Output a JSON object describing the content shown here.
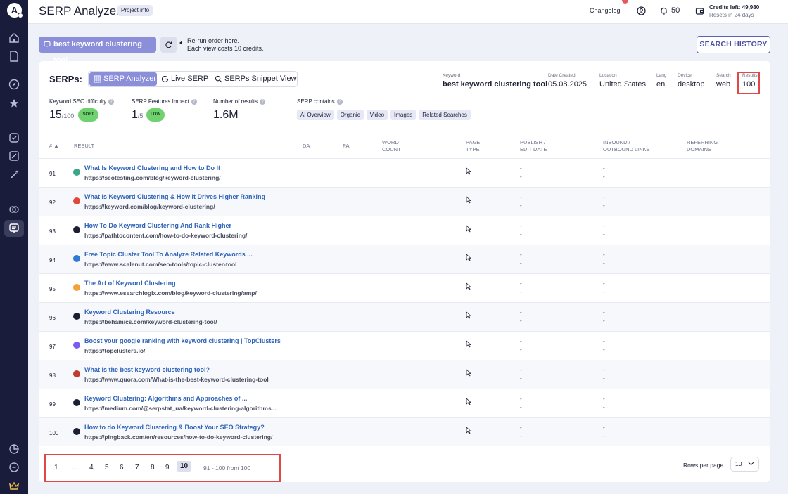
{
  "app": {
    "title": "SERP Analyzer",
    "project_info": "Project info"
  },
  "header": {
    "changelog": "Changelog",
    "notifications_count": "50",
    "credits_left": "Credits left: 49,980",
    "credits_reset": "Resets in 24 days"
  },
  "query": {
    "keyword_chip": "best keyword clustering tool",
    "rerun_line1": "Re-run order here.",
    "rerun_line2": "Each view costs 10 credits.",
    "search_history": "SEARCH HISTORY"
  },
  "serps": {
    "label": "SERPs:",
    "tabs": [
      "SERP Analyzer",
      "Live SERP",
      "SERPs Snippet View"
    ],
    "active_tab": "SERP Analyzer"
  },
  "meta": {
    "keyword_label": "Keyword",
    "keyword": "best keyword clustering tool",
    "date_label": "Date Created",
    "date": "05.08.2025",
    "location_label": "Location",
    "location": "United States",
    "lang_label": "Lang",
    "lang": "en",
    "device_label": "Device",
    "device": "desktop",
    "search_label": "Search",
    "search": "web",
    "results_label": "Results",
    "results": "100"
  },
  "metrics": {
    "difficulty_label": "Keyword SEO difficulty",
    "difficulty": "15",
    "difficulty_max": "/100",
    "difficulty_pill": "SOFT",
    "impact_label": "SERP Features Impact",
    "impact": "1",
    "impact_max": "/5",
    "impact_pill": "LOW",
    "num_results_label": "Number of results",
    "num_results": "1.6M",
    "contains_label": "SERP contains",
    "contains": [
      "Ai Overview",
      "Organic",
      "Video",
      "Images",
      "Related Searches"
    ]
  },
  "table": {
    "headers": {
      "num": "#",
      "result": "RESULT",
      "da": "DA",
      "pa": "PA",
      "word_count": [
        "WORD",
        "COUNT"
      ],
      "page_type": [
        "PAGE",
        "TYPE"
      ],
      "publish": [
        "PUBLISH /",
        "EDIT DATE"
      ],
      "links": [
        "INBOUND /",
        "OUTBOUND LINKS"
      ],
      "referring": [
        "REFERRING",
        "DOMAINS"
      ]
    },
    "rows": [
      {
        "num": "91",
        "title": "What Is Keyword Clustering and How to Do It",
        "url": "https://seotesting.com/blog/keyword-clustering/",
        "fav_color": "#3aa58a"
      },
      {
        "num": "92",
        "title": "What Is Keyword Clustering & How It Drives Higher Ranking",
        "url": "https://keyword.com/blog/keyword-clustering/",
        "fav_color": "#e0483a"
      },
      {
        "num": "93",
        "title": "How To Do Keyword Clustering And Rank Higher",
        "url": "https://pathtocontent.com/how-to-do-keyword-clustering/",
        "fav_color": "#1c1f33"
      },
      {
        "num": "94",
        "title": "Free Topic Cluster Tool To Analyze Related Keywords ...",
        "url": "https://www.scalenut.com/seo-tools/topic-cluster-tool",
        "fav_color": "#2e7bd6"
      },
      {
        "num": "95",
        "title": "The Art of Keyword Clustering",
        "url": "https://www.esearchlogix.com/blog/keyword-clustering/amp/",
        "fav_color": "#f2a33a"
      },
      {
        "num": "96",
        "title": "Keyword Clustering Resource",
        "url": "https://behamics.com/keyword-clustering-tool/",
        "fav_color": "#1c1f33"
      },
      {
        "num": "97",
        "title": "Boost your google ranking with keyword clustering | TopClusters",
        "url": "https://topclusters.io/",
        "fav_color": "#7a5cf0"
      },
      {
        "num": "98",
        "title": "What is the best keyword clustering tool?",
        "url": "https://www.quora.com/What-is-the-best-keyword-clustering-tool",
        "fav_color": "#c23b2e"
      },
      {
        "num": "99",
        "title": "Keyword Clustering: Algorithms and Approaches of ...",
        "url": "https://medium.com/@serpstat_ua/keyword-clustering-algorithms...",
        "fav_color": "#1c1f33"
      },
      {
        "num": "100",
        "title": "How to do Keyword Clustering & Boost Your SEO Strategy?",
        "url": "https://pingback.com/en/resources/how-to-do-keyword-clustering/",
        "fav_color": "#1c1f33"
      }
    ],
    "dash": "-"
  },
  "pagination": {
    "pages": [
      "1",
      "...",
      "4",
      "5",
      "6",
      "7",
      "8",
      "9",
      "10"
    ],
    "current": "10",
    "range": "91 - 100 from 100",
    "rows_per_page_label": "Rows per page",
    "rows_per_page": "10"
  },
  "colors": {
    "accent": "#8b8fd9",
    "sidebar": "#191c3a",
    "highlight": "#e04848",
    "link": "#2d63b8"
  }
}
